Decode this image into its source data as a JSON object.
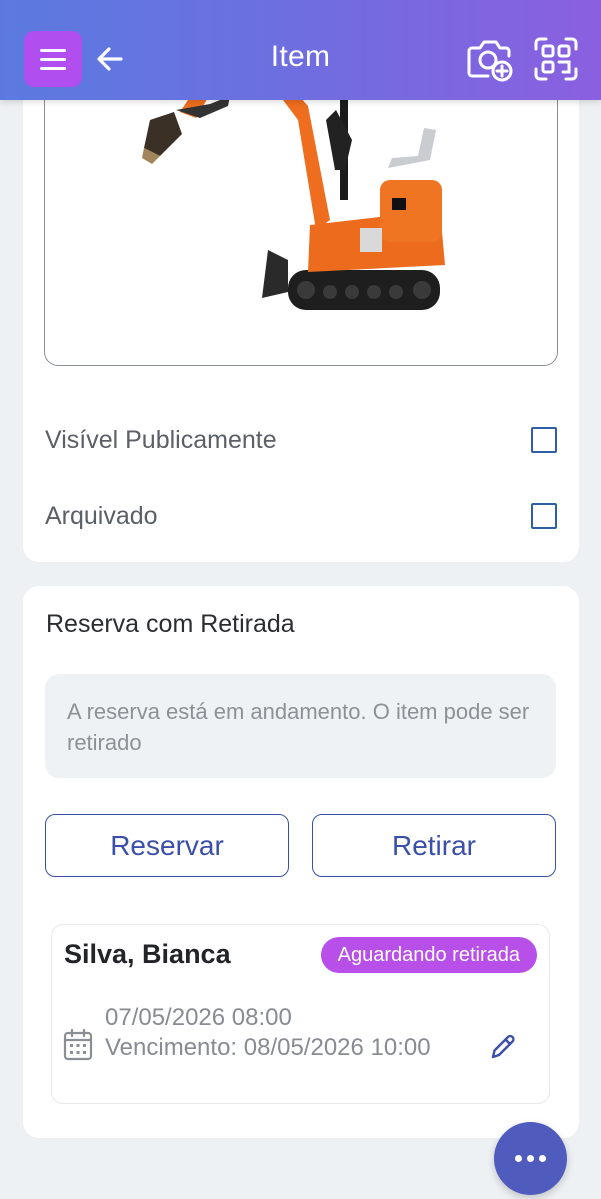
{
  "header": {
    "title": "Item",
    "menu_icon": "menu-icon",
    "back_icon": "arrow-left-icon",
    "camera_icon": "camera-add-icon",
    "qr_icon": "qr-scan-icon"
  },
  "item": {
    "photo_icon": "excavator-photo",
    "options": [
      {
        "label": "Visível Publicamente",
        "checked": false
      },
      {
        "label": "Arquivado",
        "checked": false
      }
    ]
  },
  "reservation_section": {
    "title": "Reserva com Retirada",
    "info": "A reserva está em andamento. O item pode ser retirado",
    "reserve_label": "Reservar",
    "checkout_label": "Retirar",
    "entry": {
      "name": "Silva, Bianca",
      "status": "Aguardando retirada",
      "start": "07/05/2026 08:00",
      "due": "Vencimento: 08/05/2026 10:00"
    }
  },
  "fab_icon": "more-horizontal-icon",
  "colors": {
    "header_gradient_start": "#5b7ae0",
    "header_gradient_end": "#8a5fe0",
    "menu_button": "#b04ef0",
    "primary": "#3b4fa8",
    "badge": "#b74fe8",
    "fab": "#4f5bbd"
  }
}
